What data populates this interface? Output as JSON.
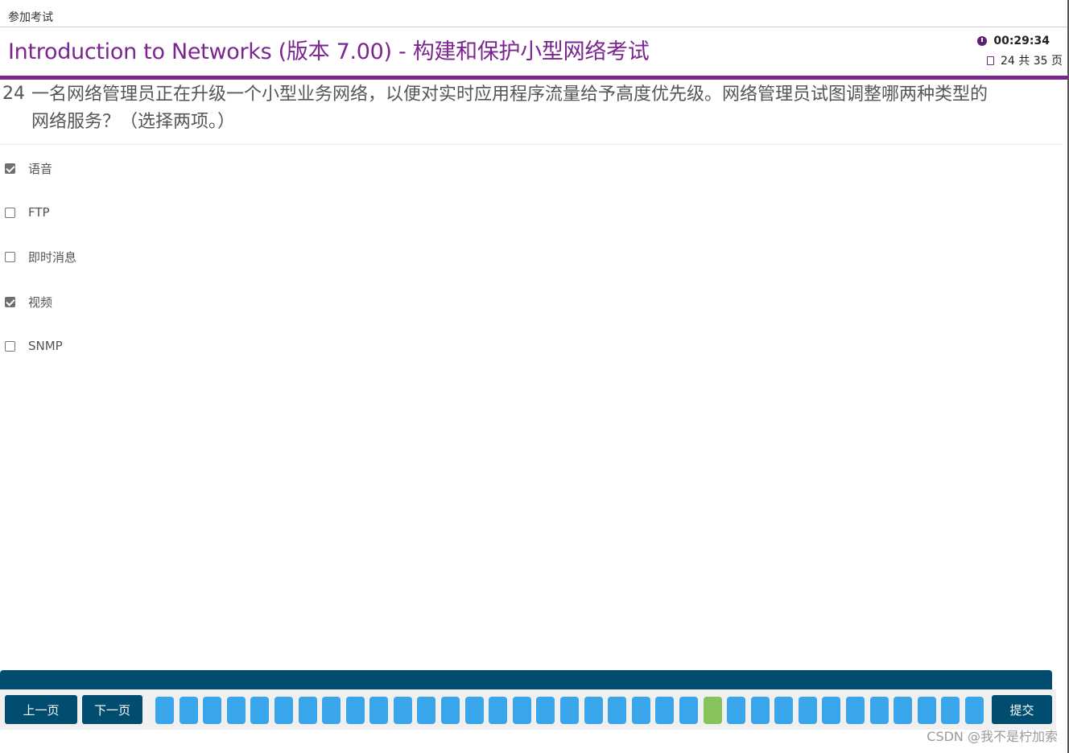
{
  "breadcrumb": "参加考试",
  "exam_title": "Introduction to Networks (版本 7.00) - 构建和保护小型网络考试",
  "timer": "00:29:34",
  "page_count": "24 共 35 页",
  "question": {
    "number": "24",
    "text": "一名网络管理员正在升级一个小型业务网络，以便对实时应用程序流量给予高度优先级。网络管理员试图调整哪两种类型的网络服务？（选择两项。）"
  },
  "options": [
    {
      "label": "语音",
      "checked": true
    },
    {
      "label": "FTP",
      "checked": false
    },
    {
      "label": "即时消息",
      "checked": false
    },
    {
      "label": "视频",
      "checked": true
    },
    {
      "label": "SNMP",
      "checked": false
    }
  ],
  "nav": {
    "prev_label": "上一页",
    "next_label": "下一页",
    "submit_label": "提交",
    "total_pages": 35,
    "current_page": 24
  },
  "colors": {
    "accent": "#7b2590",
    "nav_dark": "#014d6f",
    "page_pill": "#39a5ea",
    "page_pill_current": "#86c35b"
  },
  "watermark": "CSDN @我不是柠加索"
}
